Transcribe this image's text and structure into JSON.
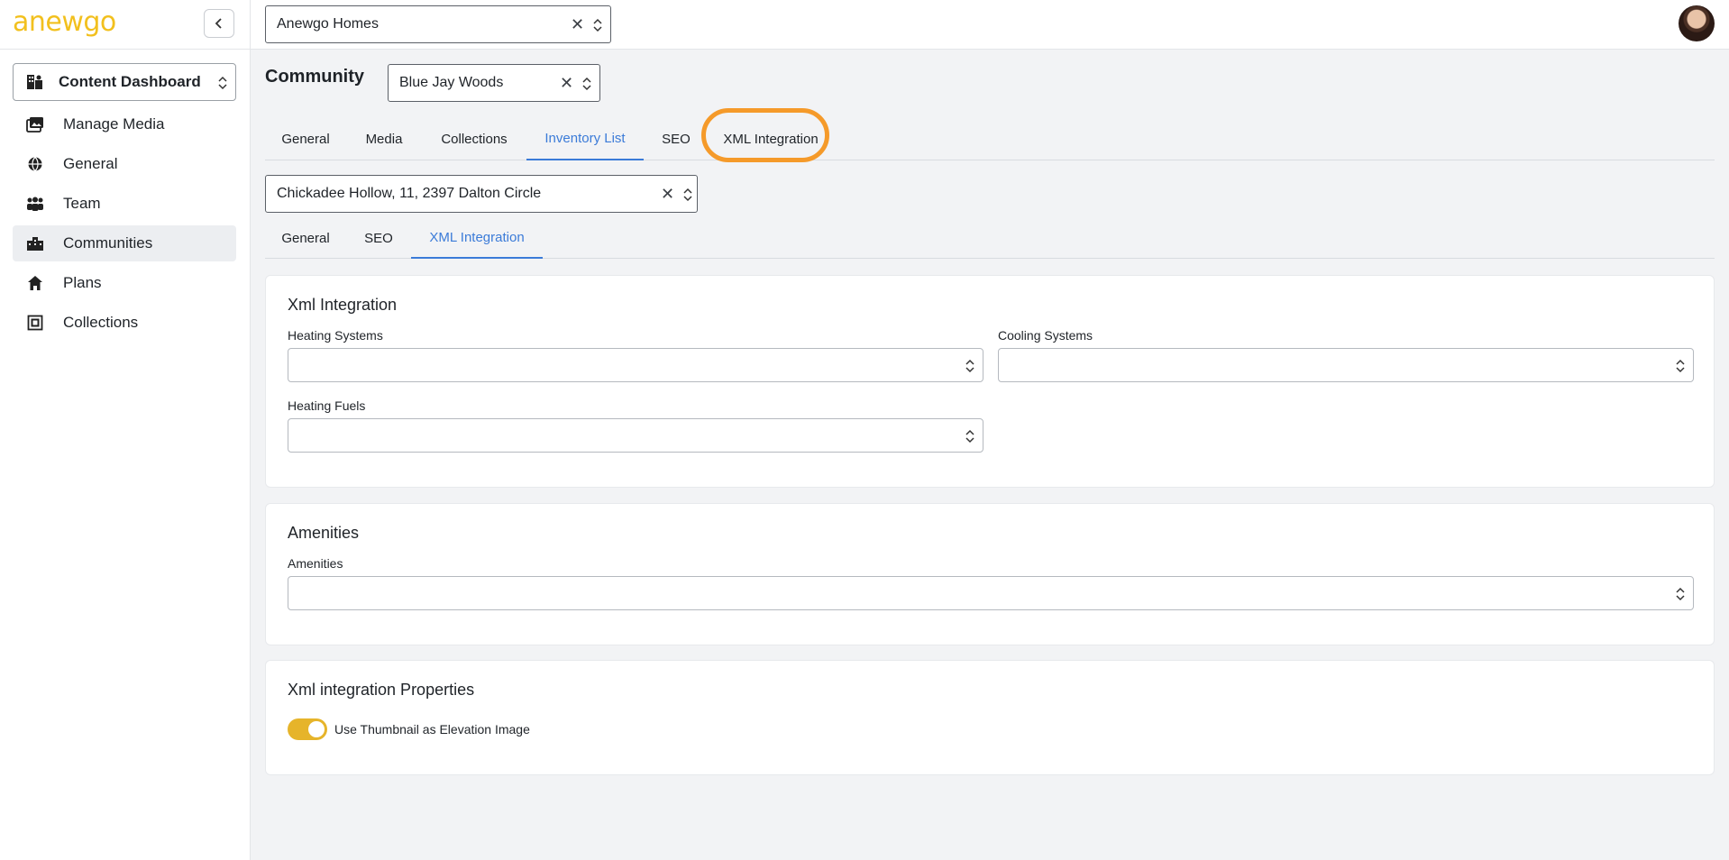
{
  "sidebar": {
    "logo": "anewgo",
    "dashboard_select": "Content Dashboard",
    "items": [
      {
        "label": "Manage Media",
        "icon": "photo-library-icon"
      },
      {
        "label": "General",
        "icon": "globe-icon"
      },
      {
        "label": "Team",
        "icon": "team-icon"
      },
      {
        "label": "Communities",
        "icon": "communities-icon",
        "active": true
      },
      {
        "label": "Plans",
        "icon": "home-icon"
      },
      {
        "label": "Collections",
        "icon": "collections-icon"
      }
    ]
  },
  "topbar": {
    "company_select": "Anewgo Homes"
  },
  "main": {
    "community_title": "Community",
    "community_select": "Blue Jay Woods",
    "tabs": [
      {
        "label": "General"
      },
      {
        "label": "Media"
      },
      {
        "label": "Collections"
      },
      {
        "label": "Inventory List",
        "active": true
      },
      {
        "label": "SEO"
      },
      {
        "label": "XML Integration",
        "highlighted": true
      }
    ],
    "lot_select": "Chickadee Hollow, 11, 2397 Dalton Circle",
    "subtabs": [
      {
        "label": "General"
      },
      {
        "label": "SEO"
      },
      {
        "label": "XML Integration",
        "active": true
      }
    ],
    "xml_card": {
      "title": "Xml Integration",
      "heating_systems_label": "Heating Systems",
      "cooling_systems_label": "Cooling Systems",
      "heating_fuels_label": "Heating Fuels"
    },
    "amenities_card": {
      "title": "Amenities",
      "amenities_label": "Amenities"
    },
    "properties_card": {
      "title": "Xml integration Properties",
      "toggle_label": "Use Thumbnail as Elevation Image",
      "toggle_on": true
    }
  },
  "colors": {
    "accent": "#3b7bd8",
    "brand_yellow": "#f2c01e",
    "highlight_orange": "#f59a2a",
    "toggle_on": "#e6b42a"
  }
}
